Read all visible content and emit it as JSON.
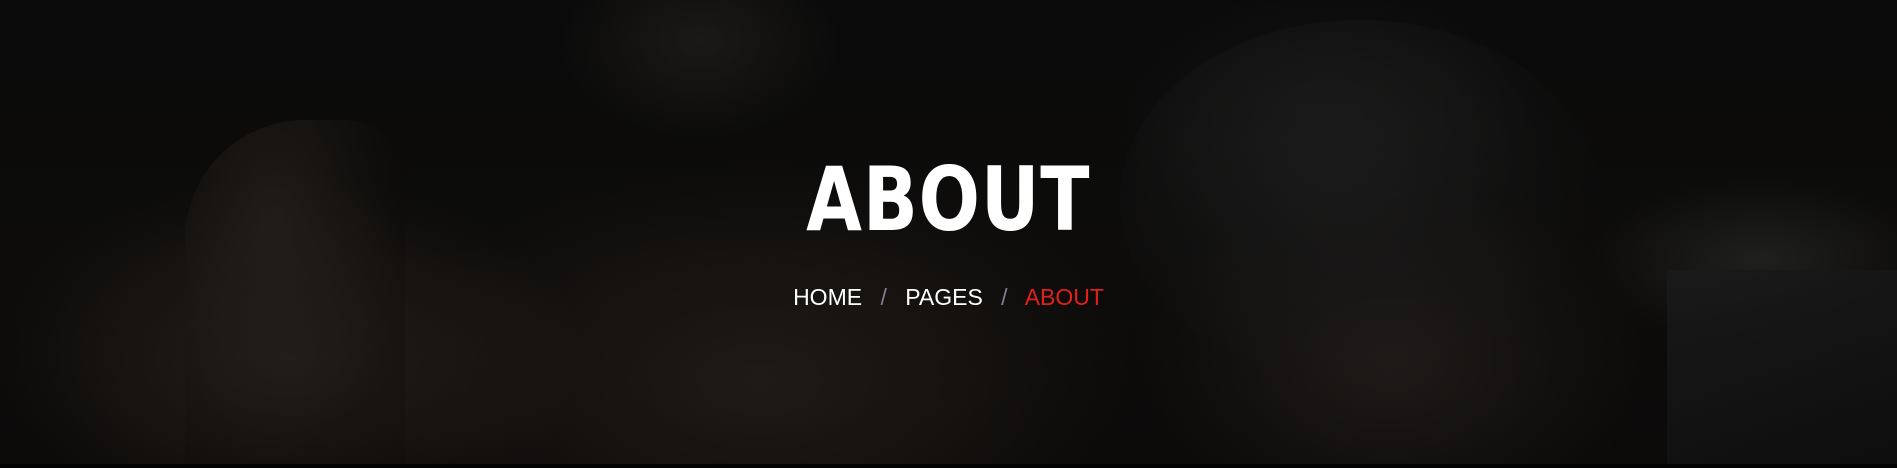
{
  "hero": {
    "title": "ABOUT"
  },
  "breadcrumb": {
    "items": [
      {
        "label": "HOME"
      },
      {
        "label": "PAGES"
      },
      {
        "label": "ABOUT"
      }
    ],
    "separator": "/"
  },
  "colors": {
    "active_breadcrumb": "#e0201d",
    "text": "#ffffff",
    "separator": "#7f7f95",
    "background": "#070707"
  }
}
